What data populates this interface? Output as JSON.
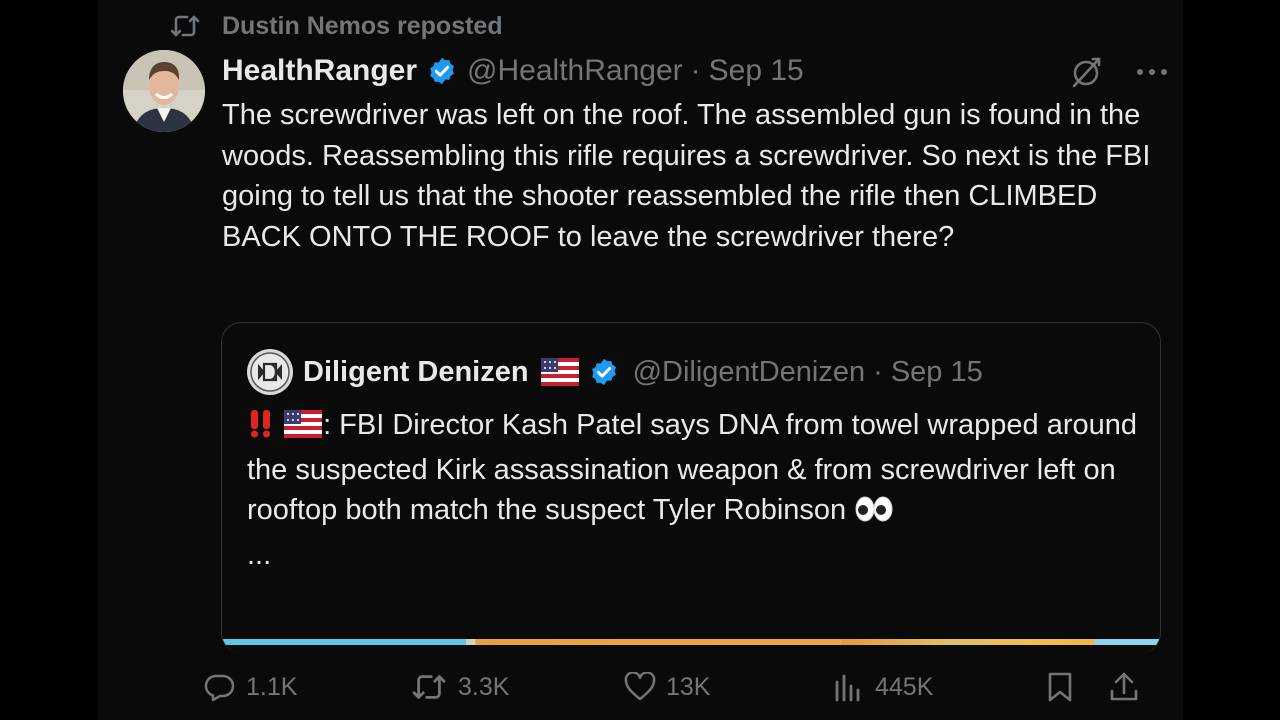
{
  "repost": {
    "label": "Dustin Nemos reposted"
  },
  "post": {
    "author_name": "HealthRanger",
    "handle": "@HealthRanger",
    "separator": "·",
    "date": "Sep 15",
    "text": "The screwdriver was left on the roof. The assembled gun is found in the woods. Reassembling this rifle requires a screwdriver. So next is the FBI going to tell us that the shooter reassembled the rifle then CLIMBED BACK ONTO THE ROOF to leave the screwdriver there?"
  },
  "quote": {
    "author_name": "Diligent Denizen",
    "handle": "@DiligentDenizen",
    "separator": "·",
    "date": "Sep 15",
    "text": ": FBI Director Kash Patel says DNA from towel wrapped around the suspected Kirk assassination weapon & from screwdriver left on rooftop both match the suspect Tyler Robinson",
    "ellipsis": "..."
  },
  "actions": {
    "replies": "1.1K",
    "reposts": "3.3K",
    "likes": "13K",
    "views": "445K"
  },
  "icons": {
    "repost": "repost-icon",
    "verified": "verified-badge-icon",
    "grok": "grok-icon",
    "more": "more-icon",
    "flag": "us-flag-icon",
    "alert": "double-exclamation-icon",
    "eyes": "eyes-icon",
    "reply": "reply-icon",
    "like": "like-icon",
    "views": "views-icon",
    "bookmark": "bookmark-icon",
    "share": "share-icon"
  },
  "colors": {
    "background": "#0a0a0a",
    "text": "#e7e9ea",
    "muted": "#71767b",
    "verified": "#1d9bf0",
    "border": "#2f3336"
  }
}
